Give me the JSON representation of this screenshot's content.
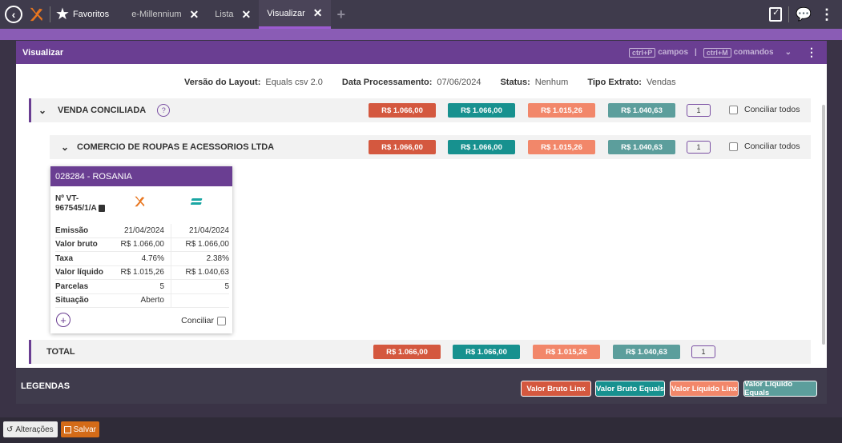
{
  "topbar": {
    "favorites_label": "Favoritos",
    "tabs": [
      {
        "label": "e-Millennium",
        "active": false
      },
      {
        "label": "Lista",
        "active": false
      },
      {
        "label": "Visualizar",
        "active": true
      }
    ],
    "add_tab": "+"
  },
  "panel": {
    "title": "Visualizar",
    "shortcut_fields_key": "ctrl+P",
    "shortcut_fields_label": "campos",
    "shortcut_sep": "|",
    "shortcut_cmds_key": "ctrl+M",
    "shortcut_cmds_label": "comandos"
  },
  "info": {
    "layout_label": "Versão do Layout:",
    "layout_value": "Equals csv 2.0",
    "date_label": "Data Processamento:",
    "date_value": "07/06/2024",
    "status_label": "Status:",
    "status_value": "Nenhum",
    "type_label": "Tipo Extrato:",
    "type_value": "Vendas"
  },
  "group": {
    "title": "VENDA CONCILIADA",
    "help": "?",
    "bruto_linx": "R$ 1.066,00",
    "bruto_equals": "R$ 1.066,00",
    "liquido_linx": "R$ 1.015,26",
    "liquido_equals": "R$ 1.040,63",
    "count": "1",
    "conciliar_label": "Conciliar todos"
  },
  "subgroup": {
    "title": "COMERCIO DE ROUPAS E ACESSORIOS LTDA",
    "bruto_linx": "R$ 1.066,00",
    "bruto_equals": "R$ 1.066,00",
    "liquido_linx": "R$ 1.015,26",
    "liquido_equals": "R$ 1.040,63",
    "count": "1",
    "conciliar_label": "Conciliar todos"
  },
  "card": {
    "title": "028284 - ROSANIA",
    "nvt_label": "Nº VT-967545/1/A",
    "rows": [
      {
        "label": "Emissão",
        "linx": "21/04/2024",
        "equals": "21/04/2024"
      },
      {
        "label": "Valor bruto",
        "linx": "R$ 1.066,00",
        "equals": "R$ 1.066,00"
      },
      {
        "label": "Taxa",
        "linx": "4.76%",
        "equals": "2.38%"
      },
      {
        "label": "Valor líquido",
        "linx": "R$ 1.015,26",
        "equals": "R$ 1.040,63"
      },
      {
        "label": "Parcelas",
        "linx": "5",
        "equals": "5"
      },
      {
        "label": "Situação",
        "linx": "Aberto",
        "equals": ""
      }
    ],
    "conciliar_label": "Conciliar"
  },
  "total": {
    "title": "TOTAL",
    "bruto_linx": "R$ 1.066,00",
    "bruto_equals": "R$ 1.066,00",
    "liquido_linx": "R$ 1.015,26",
    "liquido_equals": "R$ 1.040,63",
    "count": "1"
  },
  "legend": {
    "title": "LEGENDAS",
    "bruto_linx": "Valor Bruto Linx",
    "bruto_equals": "Valor Bruto Equals",
    "liquido_linx": "Valor Líquido Linx",
    "liquido_equals": "Valor Líquido Equals"
  },
  "bottom": {
    "alteracoes": "Alterações",
    "salvar": "Salvar"
  },
  "colors": {
    "bruto_linx": "#d4583f",
    "bruto_equals": "#17918f",
    "liquido_linx": "#f2876a",
    "liquido_equals": "#5c9e9c",
    "header_purple": "#6a3e92"
  }
}
